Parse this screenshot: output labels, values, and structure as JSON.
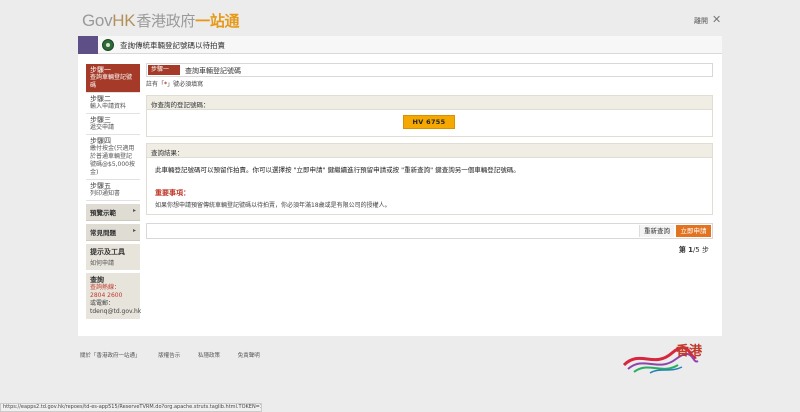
{
  "header": {
    "logo_gov": "Gov",
    "logo_hk": "HK",
    "logo_cn": "香港政府",
    "logo_cn2": "一站通",
    "exit_label": "離開",
    "exit_icon": "✕"
  },
  "titlebar": {
    "title": "查詢傳統車輛登記號碼以待拍賣"
  },
  "sidebar": {
    "steps": [
      {
        "label": "步驟一",
        "sub": "查詢車輛登記號碼"
      },
      {
        "label": "步驟二",
        "sub": "輸入申請資料"
      },
      {
        "label": "步驟三",
        "sub": "遞交申請"
      },
      {
        "label": "步驟四",
        "sub": "繳付按金(只適用於普通車輛登記號碼@$5,000按金)"
      },
      {
        "label": "步驟五",
        "sub": "列印通知書"
      }
    ],
    "demo": "預覽示範",
    "faq": "常見問題",
    "tools_head": "提示及工具",
    "tools_sub": "如何申請",
    "enquiry_head": "查詢",
    "enquiry_hotline_label": "查詢熱線：",
    "enquiry_hotline": "2804 2600",
    "enquiry_email_label": "或電郵：",
    "enquiry_email": "tdenq@td.gov.hk",
    "chevron": "▸"
  },
  "main": {
    "step_tag": "步驟一",
    "step_title": "查詢車輛登記號碼",
    "mandatory_pre": "註有「",
    "mandatory_star": "*",
    "mandatory_post": "」號必須填寫",
    "enquired_head": "你查詢的登記號碼：",
    "plate": "HV 6755",
    "result_head": "查詢結果：",
    "result_msg": "此車輛登記號碼可以預留作拍賣。你可以選擇按 \"立即申請\" 鍵繼續進行預留申請或按 \"重新查詢\" 鍵查詢另一個車輛登記號碼。",
    "note_head": "重要事項：",
    "note_text": "如果你想申請預留傳統車輛登記號碼以待拍賣，你必須年滿18歲或是有限公司的授權人。",
    "requery_btn": "重新查詢",
    "apply_btn": "立即申請",
    "page_pre": "第",
    "page_current": "1",
    "page_sep": "/5",
    "page_post": "步"
  },
  "footer": {
    "links": [
      "關於「香港政府一站通」",
      "版權告示",
      "私隱政策",
      "免責聲明"
    ],
    "brand": "香港"
  },
  "statusbar": {
    "url": "https://eapps2.td.gov.hk/repoes/td-es-app515/ReserveTVRM.do?org.apache.struts.taglib.html.TOKEN=11cb48f98b7c..."
  },
  "colors": {
    "accent_red": "#a43a27",
    "plate_yellow": "#f5a800",
    "apply_orange": "#e27321",
    "brand_purple": "#5e5087"
  }
}
